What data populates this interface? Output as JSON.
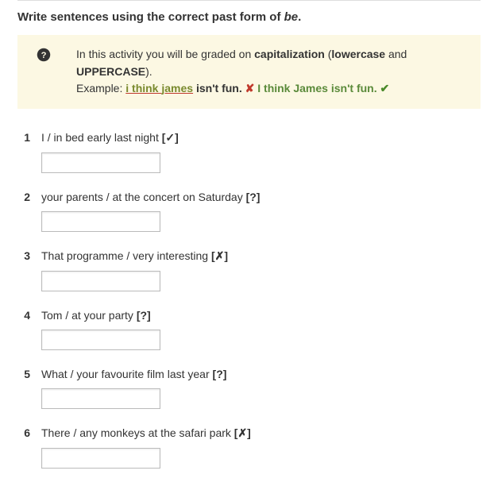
{
  "heading_prefix": "Write sentences using the correct past form of ",
  "heading_word": "be",
  "heading_suffix": ".",
  "info": {
    "line1_a": "In this activity you will be graded on ",
    "line1_b": "capitalization",
    "line1_c": " (",
    "line1_d": "lowercase",
    "line1_e": " and ",
    "line1_f": "UPPERCASE",
    "line1_g": ").",
    "example_label": "Example: ",
    "wrong1": "i think ",
    "wrong2": "james",
    "wrong3": " isn't fun.",
    "cross": " ✘ ",
    "right": "  I think James isn't fun. ",
    "check": "✔"
  },
  "questions": [
    {
      "num": "1",
      "text": "I / in bed early last night ",
      "symbol": "[✓]",
      "value": ""
    },
    {
      "num": "2",
      "text": "your parents / at the concert on Saturday ",
      "symbol": "[?]",
      "value": ""
    },
    {
      "num": "3",
      "text": "That programme / very interesting ",
      "symbol": "[✗]",
      "value": ""
    },
    {
      "num": "4",
      "text": "Tom / at your party ",
      "symbol": "[?]",
      "value": ""
    },
    {
      "num": "5",
      "text": "What / your favourite film last year ",
      "symbol": "[?]",
      "value": ""
    },
    {
      "num": "6",
      "text": "There / any monkeys at the safari park ",
      "symbol": "[✗]",
      "value": ""
    }
  ]
}
